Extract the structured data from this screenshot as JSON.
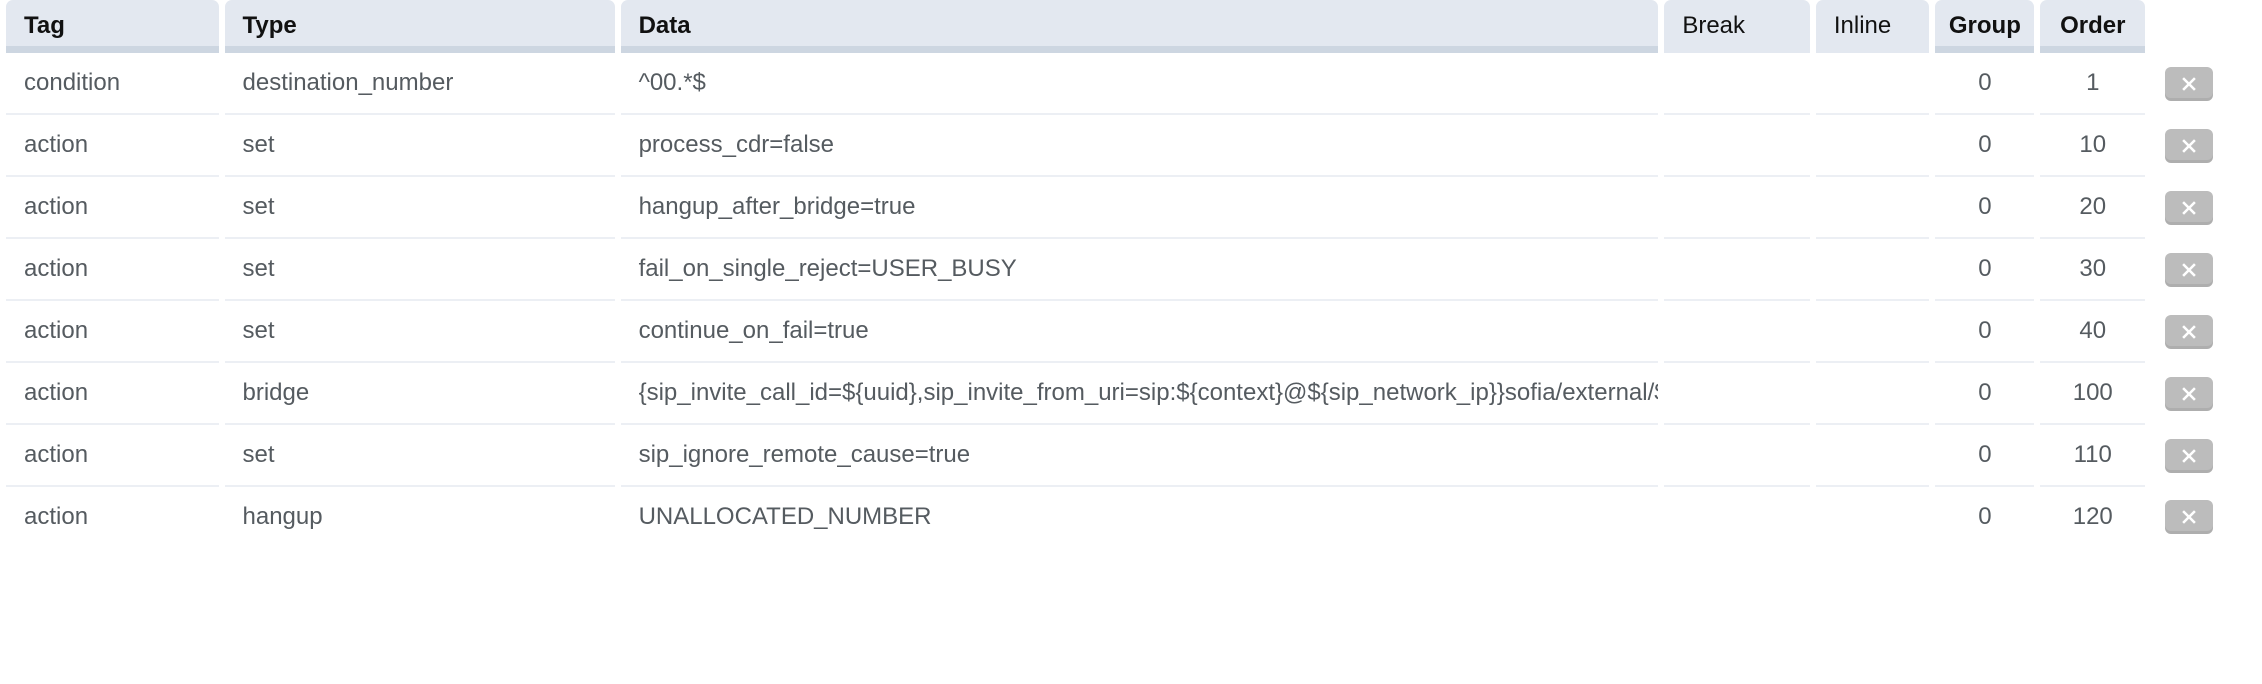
{
  "table": {
    "columns": [
      {
        "key": "tag",
        "label": "Tag",
        "bold": true,
        "align": "left"
      },
      {
        "key": "type",
        "label": "Type",
        "bold": true,
        "align": "left"
      },
      {
        "key": "data",
        "label": "Data",
        "bold": true,
        "align": "left"
      },
      {
        "key": "break",
        "label": "Break",
        "bold": false,
        "align": "left"
      },
      {
        "key": "inline",
        "label": "Inline",
        "bold": false,
        "align": "left"
      },
      {
        "key": "group",
        "label": "Group",
        "bold": true,
        "align": "center"
      },
      {
        "key": "order",
        "label": "Order",
        "bold": true,
        "align": "center"
      }
    ],
    "headers": {
      "tag": "Tag",
      "type": "Type",
      "data": "Data",
      "break": "Break",
      "inline": "Inline",
      "group": "Group",
      "order": "Order"
    },
    "rows": [
      {
        "tag": "condition",
        "type": "destination_number",
        "data": "^00.*$",
        "break": "",
        "inline": "",
        "group": "0",
        "order": "1",
        "delete_label": "✖"
      },
      {
        "tag": "action",
        "type": "set",
        "data": "process_cdr=false",
        "break": "",
        "inline": "",
        "group": "0",
        "order": "10",
        "delete_label": "✖"
      },
      {
        "tag": "action",
        "type": "set",
        "data": "hangup_after_bridge=true",
        "break": "",
        "inline": "",
        "group": "0",
        "order": "20",
        "delete_label": "✖"
      },
      {
        "tag": "action",
        "type": "set",
        "data": "fail_on_single_reject=USER_BUSY",
        "break": "",
        "inline": "",
        "group": "0",
        "order": "30",
        "delete_label": "✖"
      },
      {
        "tag": "action",
        "type": "set",
        "data": "continue_on_fail=true",
        "break": "",
        "inline": "",
        "group": "0",
        "order": "40",
        "delete_label": "✖"
      },
      {
        "tag": "action",
        "type": "bridge",
        "data": "{sip_invite_call_id=${uuid},sip_invite_from_uri=sip:${context}@${sip_network_ip}}sofia/external/${",
        "break": "",
        "inline": "",
        "group": "0",
        "order": "100",
        "delete_label": "✖"
      },
      {
        "tag": "action",
        "type": "set",
        "data": "sip_ignore_remote_cause=true",
        "break": "",
        "inline": "",
        "group": "0",
        "order": "110",
        "delete_label": "✖"
      },
      {
        "tag": "action",
        "type": "hangup",
        "data": "UNALLOCATED_NUMBER",
        "break": "",
        "inline": "",
        "group": "0",
        "order": "120",
        "delete_label": "✖"
      }
    ]
  },
  "colors": {
    "header_bg": "#e3e8f0",
    "header_shadow": "#abb7c9",
    "header_text": "#111111",
    "body_text": "#555b60",
    "row_border": "#eceff4",
    "row_bg": "#ffffff",
    "delete_button_bg": "#bcbcbc",
    "delete_icon": "#ffffff"
  }
}
